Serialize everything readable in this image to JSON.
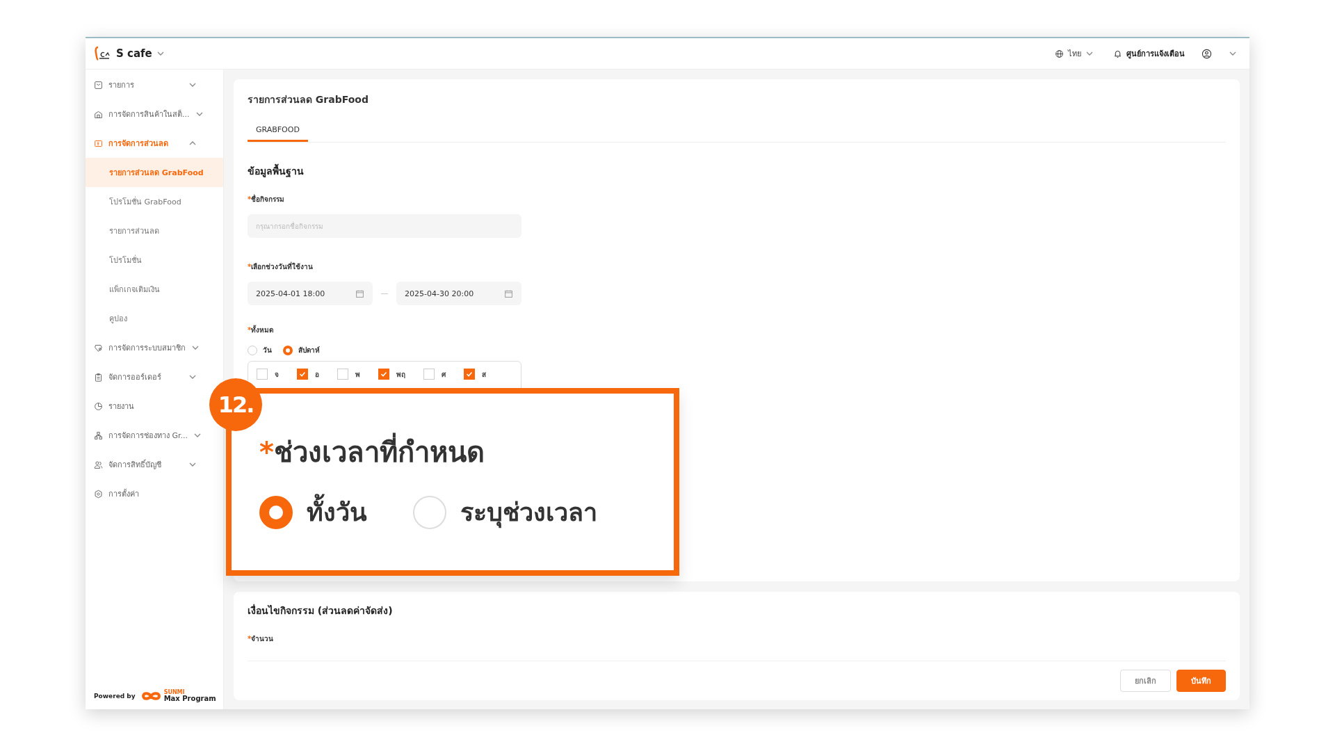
{
  "header": {
    "brand": "S cafe",
    "language": "ไทย",
    "notifications": "ศูนย์การแจ้งเตือน"
  },
  "sidebar": {
    "items": [
      {
        "label": "รายการ",
        "kind": "group",
        "expanded": false,
        "selected": false
      },
      {
        "label": "การจัดการสินค้าในสต็...",
        "kind": "group",
        "expanded": false,
        "selected": false
      },
      {
        "label": "การจัดการส่วนลด",
        "kind": "group",
        "expanded": true,
        "selected": true,
        "children": [
          {
            "label": "รายการส่วนลด GrabFood",
            "selected": true
          },
          {
            "label": "โปรโมชั่น GrabFood",
            "selected": false
          },
          {
            "label": "รายการส่วนลด",
            "selected": false
          },
          {
            "label": "โปรโมชั่น",
            "selected": false
          },
          {
            "label": "แพ็กเกจเติมเงิน",
            "selected": false
          },
          {
            "label": "คูปอง",
            "selected": false
          }
        ]
      },
      {
        "label": "การจัดการระบบสมาชิก",
        "kind": "group",
        "expanded": false,
        "selected": false
      },
      {
        "label": "จัดการออร์เดอร์",
        "kind": "group",
        "expanded": false,
        "selected": false
      },
      {
        "label": "รายงาน",
        "kind": "link",
        "selected": false
      },
      {
        "label": "การจัดการช่องทาง Gr...",
        "kind": "group",
        "expanded": false,
        "selected": false
      },
      {
        "label": "จัดการสิทธิ์บัญชี",
        "kind": "group",
        "expanded": false,
        "selected": false
      },
      {
        "label": "การตั้งค่า",
        "kind": "link",
        "selected": false
      }
    ],
    "footer": {
      "powered_by": "Powered by",
      "logo_small": "SUNMI",
      "logo_text": "Max Program"
    }
  },
  "page_title": "รายการส่วนลด GrabFood",
  "tabs": [
    {
      "label": "GRABFOOD",
      "selected": true
    }
  ],
  "basic": {
    "title": "ข้อมูลพื้นฐาน",
    "required_mark": "*",
    "name_field": {
      "label": "ชื่อกิจกรรม",
      "placeholder": "กรุณากรอกชื่อกิจกรรม"
    },
    "date_field": {
      "label": "เลือกช่วงวันที่ใช้งาน",
      "start": "2025-04-01 18:00",
      "end": "2025-04-30 20:00"
    },
    "repeat_field": {
      "label": "ทั้งหมด",
      "options": [
        {
          "label": "วัน",
          "selected": false
        },
        {
          "label": "สัปดาห์",
          "selected": true
        }
      ],
      "days": [
        {
          "label": "จ",
          "checked": false
        },
        {
          "label": "อ",
          "checked": true
        },
        {
          "label": "พ",
          "checked": false
        },
        {
          "label": "พฤ",
          "checked": true
        },
        {
          "label": "ศ",
          "checked": false
        },
        {
          "label": "ส",
          "checked": true
        }
      ]
    }
  },
  "callout": {
    "number": "12.",
    "required_mark": "*",
    "label": "ช่วงเวลาที่กำหนด",
    "options": [
      {
        "label": "ทั้งวัน",
        "selected": true
      },
      {
        "label": "ระบุช่วงเวลา",
        "selected": false
      }
    ]
  },
  "conditions": {
    "title": "เงื่อนไขกิจกรรม (ส่วนลดค่าจัดส่ง)",
    "required_mark": "*",
    "field_label": "จำนวน"
  },
  "buttons": [
    {
      "label": "ยกเลิก",
      "kind": "secondary"
    },
    {
      "label": "บันทึก",
      "kind": "primary"
    }
  ]
}
